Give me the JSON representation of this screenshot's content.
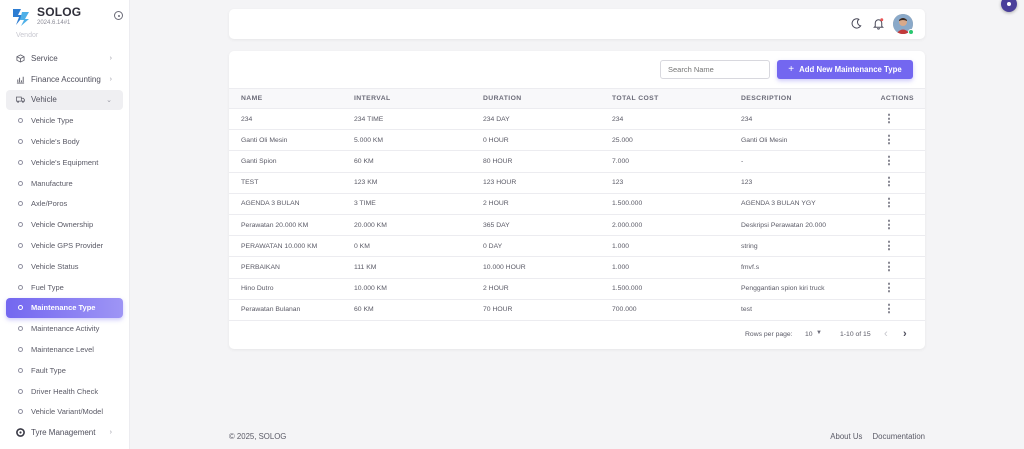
{
  "brand": {
    "name": "SOLOG",
    "version": "2024.6.14#1"
  },
  "sidebar": {
    "ghost_item": "Vendor",
    "items": [
      {
        "label": "Service",
        "icon": "box-icon",
        "expandable": true
      },
      {
        "label": "Finance Accounting",
        "icon": "chart-icon",
        "expandable": true
      },
      {
        "label": "Vehicle",
        "icon": "truck-icon",
        "expandable": true,
        "open": true
      }
    ],
    "subitems": [
      {
        "label": "Vehicle Type"
      },
      {
        "label": "Vehicle's Body"
      },
      {
        "label": "Vehicle's Equipment"
      },
      {
        "label": "Manufacture"
      },
      {
        "label": "Axle/Poros"
      },
      {
        "label": "Vehicle Ownership"
      },
      {
        "label": "Vehicle GPS Provider"
      },
      {
        "label": "Vehicle Status"
      },
      {
        "label": "Fuel Type"
      },
      {
        "label": "Maintenance Type",
        "active": true
      },
      {
        "label": "Maintenance Activity"
      },
      {
        "label": "Maintenance Level"
      },
      {
        "label": "Fault Type"
      },
      {
        "label": "Driver Health Check"
      },
      {
        "label": "Vehicle Variant/Model"
      }
    ],
    "after_item": {
      "label": "Tyre Management",
      "icon": "tyre-icon",
      "expandable": true
    }
  },
  "toolbar": {
    "search_placeholder": "Search Name",
    "add_label": "Add New Maintenance Type"
  },
  "table": {
    "headers": [
      "NAME",
      "INTERVAL",
      "DURATION",
      "TOTAL COST",
      "DESCRIPTION",
      "ACTIONS"
    ],
    "rows": [
      [
        "234",
        "234 TIME",
        "234 DAY",
        "234",
        "234"
      ],
      [
        "Ganti Oli Mesin",
        "5.000 KM",
        "0 HOUR",
        "25.000",
        "Ganti Oli Mesin"
      ],
      [
        "Ganti Spion",
        "60 KM",
        "80 HOUR",
        "7.000",
        "-"
      ],
      [
        "TEST",
        "123 KM",
        "123 HOUR",
        "123",
        "123"
      ],
      [
        "AGENDA 3 BULAN",
        "3 TIME",
        "2 HOUR",
        "1.500.000",
        "AGENDA 3 BULAN YGY"
      ],
      [
        "Perawatan 20.000 KM",
        "20.000 KM",
        "365 DAY",
        "2.000.000",
        "Deskripsi Perawatan 20.000"
      ],
      [
        "PERAWATAN 10.000 KM",
        "0 KM",
        "0 DAY",
        "1.000",
        "string"
      ],
      [
        "PERBAIKAN",
        "111 KM",
        "10.000 HOUR",
        "1.000",
        "fmvf.s"
      ],
      [
        "Hino Dutro",
        "10.000 KM",
        "2 HOUR",
        "1.500.000",
        "Penggantian spion kiri truck"
      ],
      [
        "Perawatan Bulanan",
        "60 KM",
        "70 HOUR",
        "700.000",
        "test"
      ]
    ]
  },
  "pagination": {
    "rows_per_page_label": "Rows per page:",
    "rows_per_page": "10",
    "range": "1-10 of 15"
  },
  "footer": {
    "copyright": "© 2025, SOLOG",
    "links": [
      "About Us",
      "Documentation"
    ]
  },
  "colors": {
    "primary": "#7367f0",
    "online": "#28c76f",
    "notification": "#ea5455"
  }
}
